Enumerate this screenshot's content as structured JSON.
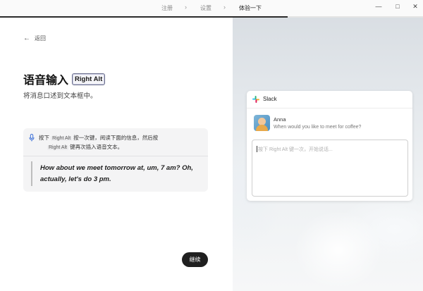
{
  "topbar": {
    "steps": [
      {
        "label": "注册",
        "active": false
      },
      {
        "label": "设置",
        "active": false
      },
      {
        "label": "体验一下",
        "active": true
      }
    ],
    "separator": "›",
    "window_controls": {
      "minimize": "—",
      "maximize": "□",
      "close": "✕"
    },
    "progress_fraction": 0.68
  },
  "left": {
    "back_label": "返回",
    "back_icon": "←",
    "title": "语音输入",
    "hotkey_badge": "Right Alt",
    "subtitle": "将消息口述到文本框中。",
    "instruction": {
      "prefix": "按下",
      "key1": "Right Alt",
      "middle": "按一次键，阅读下面的信息，然后按",
      "key2": "Right Alt",
      "suffix": "键再次插入语音文本。"
    },
    "quote": "How about we meet tomorrow at, um, 7 am? Oh, actually, let's do 3 pm.",
    "continue_label": "继续"
  },
  "right": {
    "app_name": "Slack",
    "message": {
      "sender": "Anna",
      "text": "When would you like to meet for coffee?"
    },
    "compose_placeholder": "按下 Right Alt 键一次，开始说话..."
  },
  "colors": {
    "accent_dark": "#1f1f1f",
    "mic_blue": "#3b6fd8",
    "badge_border": "#6b6f8c"
  },
  "icons": {
    "back": "left-arrow-icon",
    "mic": "microphone-icon",
    "slack": "slack-logo-icon",
    "avatar": "anna-avatar"
  }
}
